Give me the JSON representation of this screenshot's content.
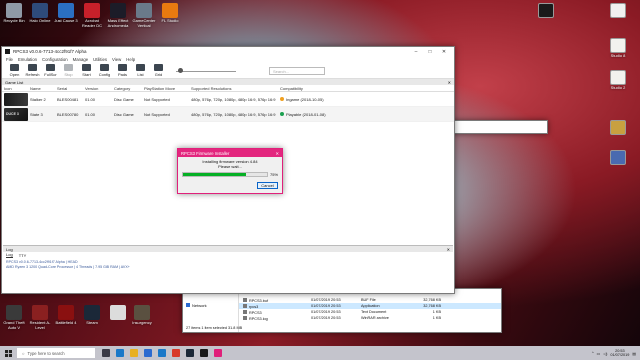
{
  "desktop": {
    "icons_left": [
      {
        "label": "Recycle Bin",
        "color": "#8f9aa6"
      },
      {
        "label": "Halo Online",
        "color": "#2e4b7a"
      },
      {
        "label": "Just Cause 3",
        "color": "#2b6fc2"
      },
      {
        "label": "Acrobat Reader DC",
        "color": "#c8202a"
      },
      {
        "label": "Mass Effect Andromeda",
        "color": "#1c1c28"
      },
      {
        "label": "GameCenter Vertical",
        "color": "#6a7a8a"
      },
      {
        "label": "FL Studio",
        "color": "#e87a10"
      }
    ],
    "icons_bottom": [
      {
        "label": "Grand Theft Auto V",
        "color": "#3a3a3a"
      },
      {
        "label": "Resident A-Level",
        "color": "#8a2020"
      },
      {
        "label": "Battlefield 4",
        "color": "#8a1010"
      },
      {
        "label": "Steam",
        "color": "#1b2838"
      },
      {
        "label": "",
        "color": "#dcdcdc"
      },
      {
        "label": "Insurgency",
        "color": "#5a5040"
      }
    ],
    "icons_right": [
      {
        "label": "",
        "color": "#1a1a1a"
      },
      {
        "label": "",
        "color": "#f0f0f0"
      },
      {
        "label": "Studio 8",
        "color": "#f2f2ee"
      },
      {
        "label": "Studio 2",
        "color": "#f2f2ee"
      },
      {
        "label": "",
        "color": "#c8a040"
      },
      {
        "label": "",
        "color": "#4a6ab0"
      }
    ]
  },
  "rpcs3": {
    "title": "RPCS3 v0.0.6-7713-4cc2f91f7 Alpha",
    "menu": [
      "File",
      "Emulation",
      "Configuration",
      "Manage",
      "Utilities",
      "View",
      "Help"
    ],
    "toolbar": [
      {
        "label": "Open",
        "enabled": true
      },
      {
        "label": "Refresh",
        "enabled": true
      },
      {
        "label": "FullScr",
        "enabled": true
      },
      {
        "label": "Stop",
        "enabled": false
      },
      {
        "label": "Start",
        "enabled": true
      },
      {
        "label": "Config",
        "enabled": true
      },
      {
        "label": "Pads",
        "enabled": true
      },
      {
        "label": "List",
        "enabled": true
      },
      {
        "label": "Grid",
        "enabled": true
      }
    ],
    "search_placeholder": "Search...",
    "game_list_label": "Game List",
    "columns": [
      "Icon",
      "Name",
      "Serial",
      "Version",
      "Category",
      "PlayStation Move",
      "Supported Resolutions",
      "Compatibility"
    ],
    "games": [
      {
        "thumb": "s2",
        "name": "Stalker 2",
        "serial": "BLES00481",
        "version": "01.00",
        "category": "Disc Game",
        "move": "Not Supported",
        "resolutions": "480p, 576p, 720p, 1080p, 480p 16:9, 576p 16:9",
        "compat": "Ingame (2018-10-05)",
        "compat_color": "#f0a020"
      },
      {
        "thumb": "s3",
        "name": "State 3",
        "serial": "BLES00780",
        "version": "01.00",
        "category": "Disc Game",
        "move": "Not Supported",
        "resolutions": "480p, 576p, 720p, 1080p, 480p 16:9, 576p 16:9",
        "compat": "Playable (2018-01-08)",
        "compat_color": "#1ca050"
      }
    ],
    "log_label": "Log",
    "log_tabs": [
      "Log",
      "TTY"
    ],
    "log_lines": [
      "RPCS3 v0.0.6-7713-4cc2f91f7 Alpha | HEAD",
      "AMD Ryzen 3 1200 Quad-Core Processor | 4 Threads | 7.95 GiB RAM | AVX+"
    ]
  },
  "dialog": {
    "title": "RPCS3 Firmware Installer",
    "message_1": "Installing firmware version 4.84",
    "message_2": "Please wait...",
    "progress": 0.75,
    "progress_label": "75%",
    "cancel": "Cancel"
  },
  "explorer": {
    "nav": [
      "Network"
    ],
    "files": [
      {
        "name": "RPCS3.buf",
        "date": "01/07/2019 20:53",
        "type": "BUF File",
        "size": "32,768 KB"
      },
      {
        "name": "rpcs3",
        "date": "01/07/2019 20:53",
        "type": "Application",
        "size": "32,768 KB"
      },
      {
        "name": "RPCS3",
        "date": "01/07/2019 20:53",
        "type": "Text Document",
        "size": "1 KB"
      },
      {
        "name": "RPCS3.log",
        "date": "01/07/2019 20:53",
        "type": "WinRAR archive",
        "size": "1 KB"
      }
    ],
    "status": "27 items      1 item selected  31.8 MB"
  },
  "taskbar": {
    "search_placeholder": "Type here to search",
    "apps": [
      {
        "name": "task-view",
        "color": "#3a3a46"
      },
      {
        "name": "edge",
        "color": "#1a78c8"
      },
      {
        "name": "file-explorer",
        "color": "#e8b020"
      },
      {
        "name": "store",
        "color": "#2a6ad0"
      },
      {
        "name": "mail",
        "color": "#1a78c8"
      },
      {
        "name": "chrome",
        "color": "#d83a2a"
      },
      {
        "name": "steam",
        "color": "#1b2838"
      },
      {
        "name": "rpcs3",
        "color": "#1a1a1a"
      },
      {
        "name": "app-pink",
        "color": "#e0207a"
      }
    ],
    "time": "20:53",
    "date": "01/07/2019"
  }
}
